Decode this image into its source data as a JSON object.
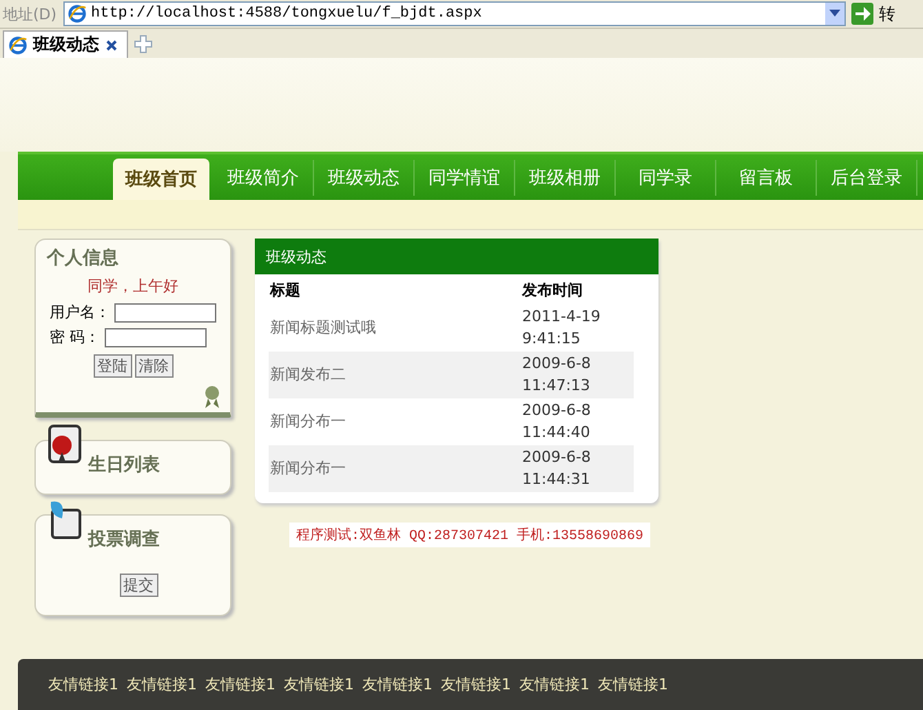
{
  "browser": {
    "address_label": "地址(D)",
    "url": "http://localhost:4588/tongxuelu/f_bjdt.aspx",
    "go_label": "转",
    "tab_title": "班级动态"
  },
  "nav": [
    {
      "label": "班级首页",
      "selected": true
    },
    {
      "label": "班级简介",
      "selected": false
    },
    {
      "label": "班级动态",
      "selected": false
    },
    {
      "label": "同学情谊",
      "selected": false
    },
    {
      "label": "班级相册",
      "selected": false
    },
    {
      "label": "同学录",
      "selected": false
    },
    {
      "label": "留言板",
      "selected": false
    },
    {
      "label": "后台登录",
      "selected": false
    }
  ],
  "login": {
    "title": "个人信息",
    "greeting": "同学，上午好",
    "fields": [
      {
        "label": "用户名："
      },
      {
        "label": "密 码："
      }
    ],
    "buttons": [
      "登陆",
      "清除"
    ]
  },
  "birthday": {
    "title": "生日列表"
  },
  "vote": {
    "title": "投票调查",
    "button": "提交"
  },
  "news": {
    "title": "班级动态",
    "columns": [
      "标题",
      "发布时间"
    ],
    "rows": [
      {
        "title": "新闻标题测试哦",
        "date": "2011-4-19",
        "time": "9:41:15"
      },
      {
        "title": "新闻发布二",
        "date": "2009-6-8",
        "time": "11:47:13"
      },
      {
        "title": "新闻分布一",
        "date": "2009-6-8",
        "time": "11:44:40"
      },
      {
        "title": "新闻分布一",
        "date": "2009-6-8",
        "time": "11:44:31"
      }
    ]
  },
  "credit": "程序测试:双鱼林 QQ:287307421 手机:13558690869",
  "footer_links": [
    "友情链接1",
    "友情链接1",
    "友情链接1",
    "友情链接1",
    "友情链接1",
    "友情链接1",
    "友情链接1",
    "友情链接1"
  ]
}
